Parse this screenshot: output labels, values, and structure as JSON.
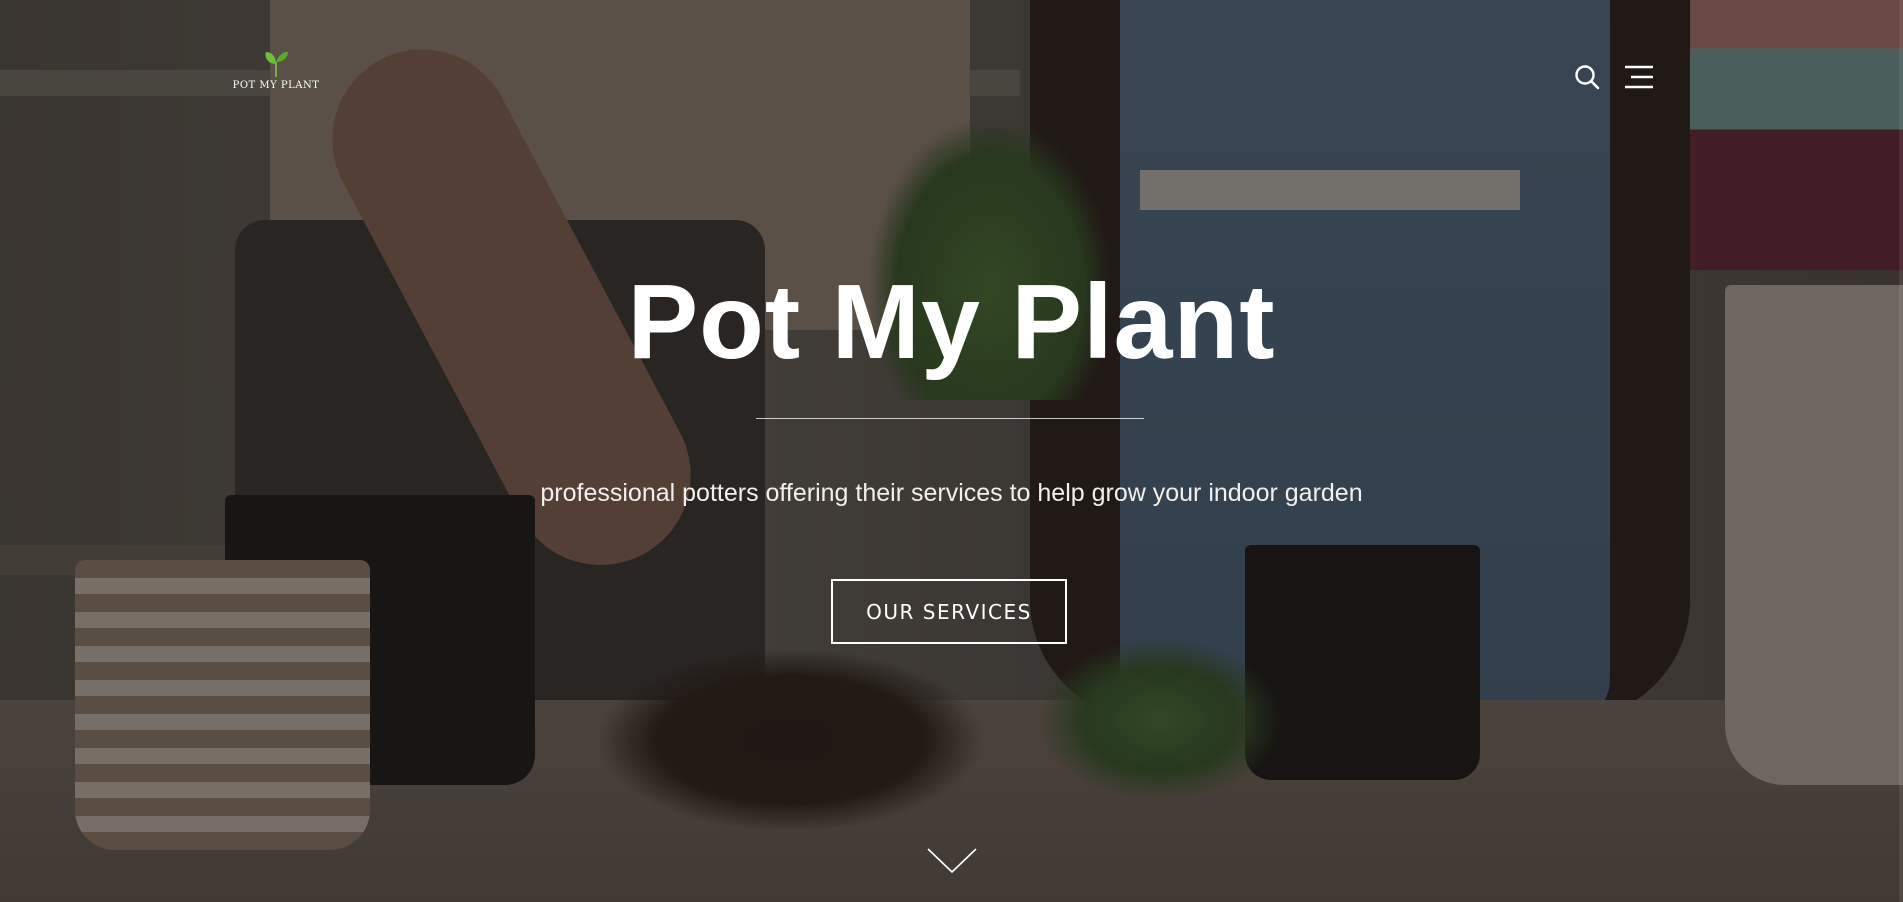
{
  "site": {
    "logo_text": "POT MY PLANT"
  },
  "header": {
    "icons": [
      "search-icon",
      "menu-icon"
    ]
  },
  "hero": {
    "title": "Pot My Plant",
    "subtitle": "professional potters offering their services to help grow your indoor garden",
    "cta_label": "OUR SERVICES",
    "scroll_icon": "chevron-down-icon"
  },
  "colors": {
    "text": "#ffffff",
    "overlay": "#14100e",
    "logo_leaf": "#6fbf3a"
  }
}
